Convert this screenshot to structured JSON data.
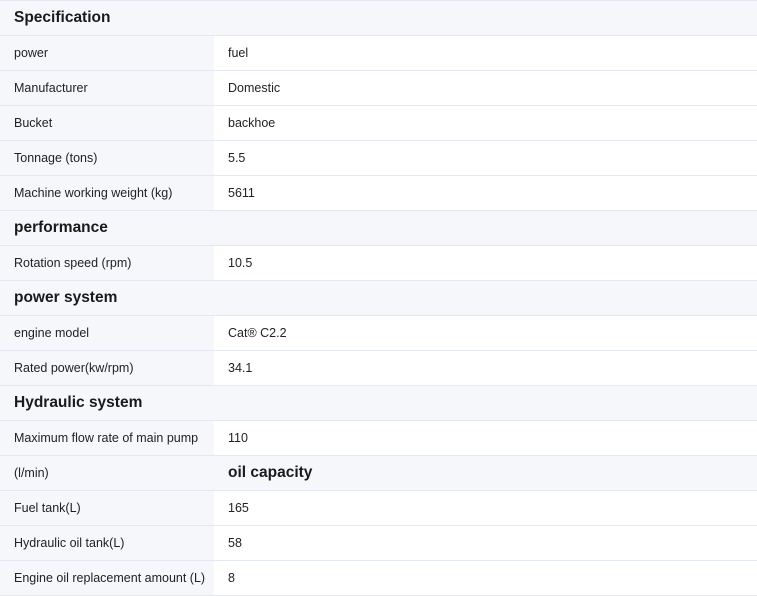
{
  "sections": {
    "specification": {
      "title": "Specification",
      "rows": [
        {
          "label": "power",
          "value": "fuel"
        },
        {
          "label": "Manufacturer",
          "value": "Domestic"
        },
        {
          "label": "Bucket",
          "value": "backhoe"
        },
        {
          "label": "Tonnage (tons)",
          "value": "5.5"
        },
        {
          "label": "Machine working weight (kg)",
          "value": "5611"
        }
      ]
    },
    "performance": {
      "title": "performance",
      "rows": [
        {
          "label": "Rotation speed (rpm)",
          "value": "10.5"
        }
      ]
    },
    "power_system": {
      "title": "power system",
      "rows": [
        {
          "label": "engine model",
          "value": "Cat® C2.2"
        },
        {
          "label": "Rated power(kw/rpm)",
          "value": "34.1"
        }
      ]
    },
    "hydraulic_system": {
      "title": "Hydraulic system",
      "rows": [
        {
          "label": "Maximum flow rate of main pump",
          "value": "110"
        }
      ],
      "overflow_label": "(l/min)"
    },
    "oil_capacity": {
      "title": "oil capacity",
      "rows": [
        {
          "label": "Fuel tank(L)",
          "value": "165"
        },
        {
          "label": "Hydraulic oil tank(L)",
          "value": "58"
        },
        {
          "label": "Engine oil replacement amount (L)",
          "value": "8"
        }
      ]
    }
  }
}
